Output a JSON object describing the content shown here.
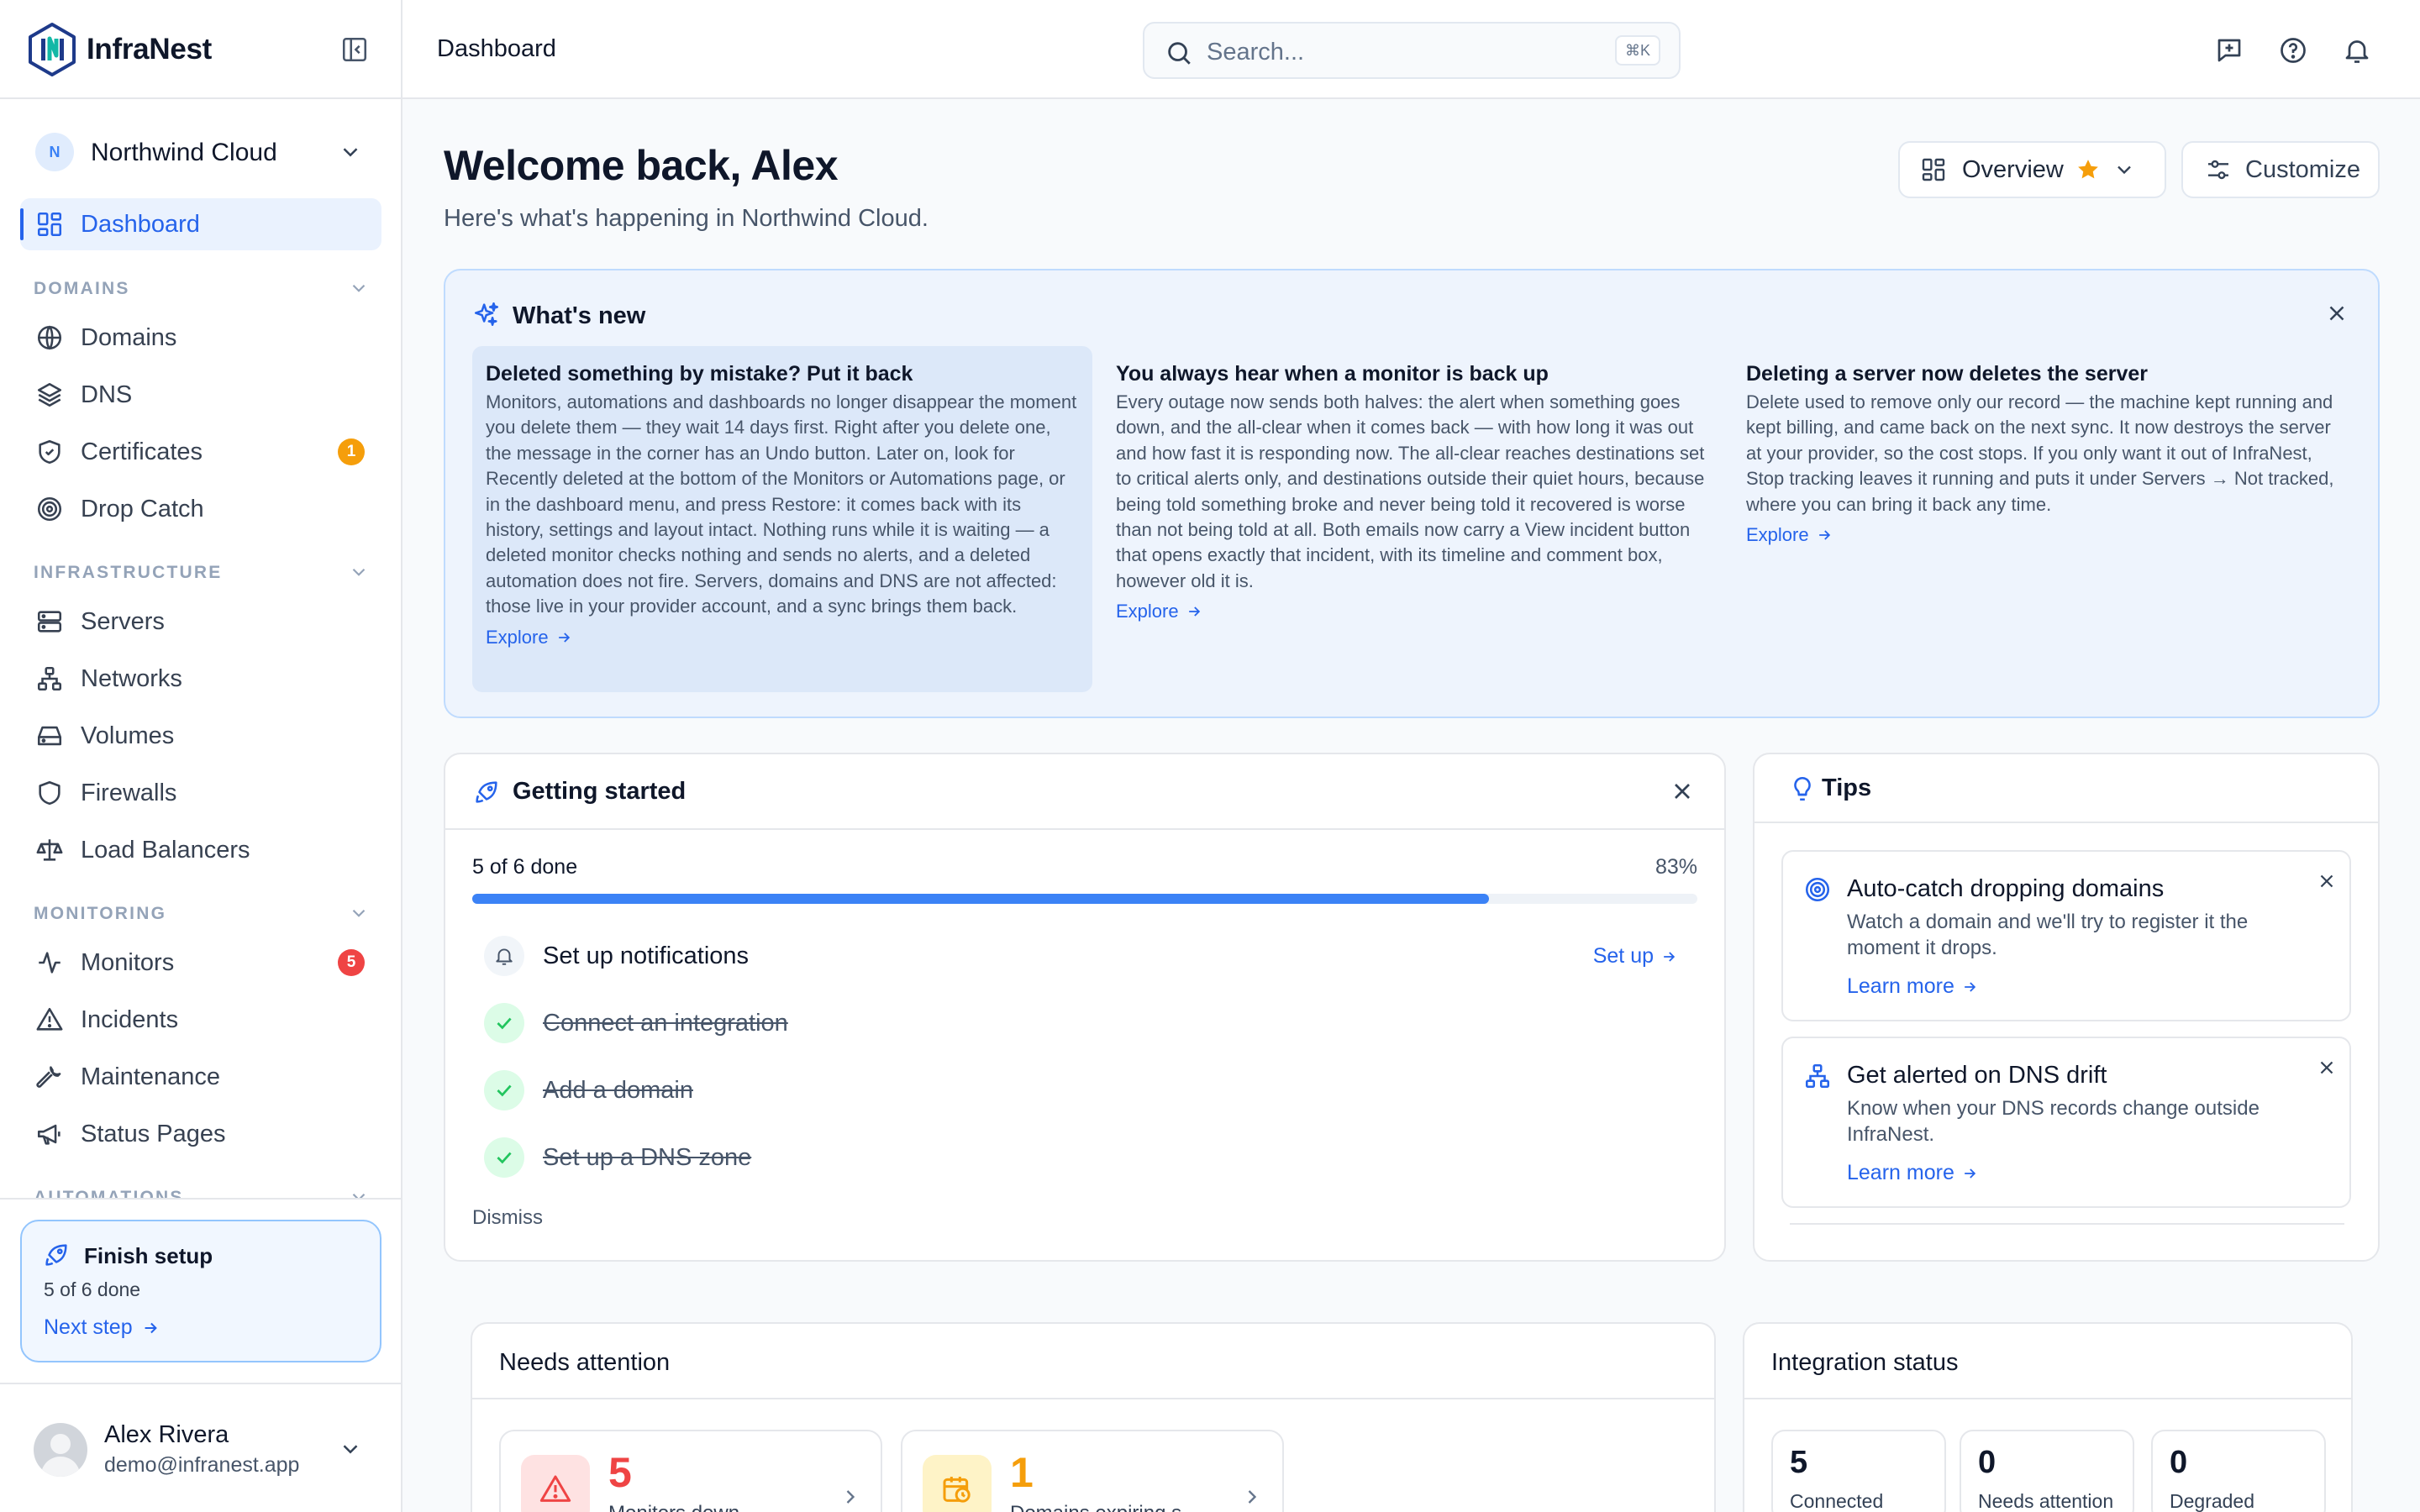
{
  "app": {
    "name": "InfraNest",
    "page_title": "Dashboard"
  },
  "org": {
    "initial": "N",
    "name": "Northwind Cloud"
  },
  "nav": {
    "dashboard": "Dashboard",
    "sections": {
      "domains": "DOMAINS",
      "infrastructure": "INFRASTRUCTURE",
      "monitoring": "MONITORING",
      "automations": "AUTOMATIONS"
    },
    "items": {
      "domains": "Domains",
      "dns": "DNS",
      "certificates": "Certificates",
      "drop_catch": "Drop Catch",
      "servers": "Servers",
      "networks": "Networks",
      "volumes": "Volumes",
      "firewalls": "Firewalls",
      "load_balancers": "Load Balancers",
      "monitors": "Monitors",
      "incidents": "Incidents",
      "maintenance": "Maintenance",
      "status_pages": "Status Pages"
    },
    "badges": {
      "certificates": "1",
      "monitors": "5"
    }
  },
  "finish_setup": {
    "title": "Finish setup",
    "progress": "5 of 6 done",
    "link": "Next step"
  },
  "user": {
    "name": "Alex Rivera",
    "email": "demo@infranest.app"
  },
  "search": {
    "placeholder": "Search...",
    "shortcut": "⌘K"
  },
  "header": {
    "title": "Welcome back, Alex",
    "subtitle": "Here's what's happening in Northwind Cloud.",
    "view_label": "Overview",
    "customize_label": "Customize"
  },
  "whats_new": {
    "title": "What's new",
    "items": [
      {
        "title": "Deleted something by mistake? Put it back",
        "body": "Monitors, automations and dashboards no longer disappear the moment you delete them — they wait 14 days first. Right after you delete one, the message in the corner has an Undo button. Later on, look for Recently deleted at the bottom of the Monitors or Automations page, or in the dashboard menu, and press Restore: it comes back with its history, settings and layout intact. Nothing runs while it is waiting — a deleted monitor checks nothing and sends no alerts, and a deleted automation does not fire. Servers, domains and DNS are not affected: those live in your provider account, and a sync brings them back.",
        "link": "Explore"
      },
      {
        "title": "You always hear when a monitor is back up",
        "body": "Every outage now sends both halves: the alert when something goes down, and the all-clear when it comes back — with how long it was out and how fast it is responding now. The all-clear reaches destinations set to critical alerts only, and destinations outside their quiet hours, because being told something broke and never being told it recovered is worse than not being told at all. Both emails now carry a View incident button that opens exactly that incident, with its timeline and comment box, however old it is.",
        "link": "Explore"
      },
      {
        "title": "Deleting a server now deletes the server",
        "body": "Delete used to remove only our record — the machine kept running and kept billing, and came back on the next sync. It now destroys the server at your provider, so the cost stops. If you only want it out of InfraNest, Stop tracking leaves it running and puts it under Servers → Not tracked, where you can bring it back any time.",
        "link": "Explore"
      }
    ]
  },
  "getting_started": {
    "title": "Getting started",
    "progress_label": "5 of 6 done",
    "percent_label": "83%",
    "progress": 0.83,
    "tasks": [
      {
        "label": "Set up notifications",
        "action": "Set up"
      },
      {
        "label": "Connect an integration"
      },
      {
        "label": "Add a domain"
      },
      {
        "label": "Set up a DNS zone"
      }
    ],
    "dismiss": "Dismiss"
  },
  "tips": {
    "title": "Tips",
    "items": [
      {
        "title": "Auto-catch dropping domains",
        "body": "Watch a domain and we'll try to register it the moment it drops.",
        "link": "Learn more"
      },
      {
        "title": "Get alerted on DNS drift",
        "body": "Know when your DNS records change outside InfraNest.",
        "link": "Learn more"
      }
    ]
  },
  "needs_attention": {
    "title": "Needs attention",
    "cards": [
      {
        "value": "5",
        "label": "Monitors down",
        "color": "#ef4444"
      },
      {
        "value": "1",
        "label": "Domains expiring s",
        "color": "#f59e0b"
      }
    ]
  },
  "integration_status": {
    "title": "Integration status",
    "counts": [
      {
        "value": "5",
        "label": "Connected"
      },
      {
        "value": "0",
        "label": "Needs attention"
      },
      {
        "value": "0",
        "label": "Degraded"
      }
    ]
  },
  "colors": {
    "accent": "#2563eb",
    "success": "#22c55e",
    "danger": "#ef4444",
    "warning": "#f59e0b"
  }
}
